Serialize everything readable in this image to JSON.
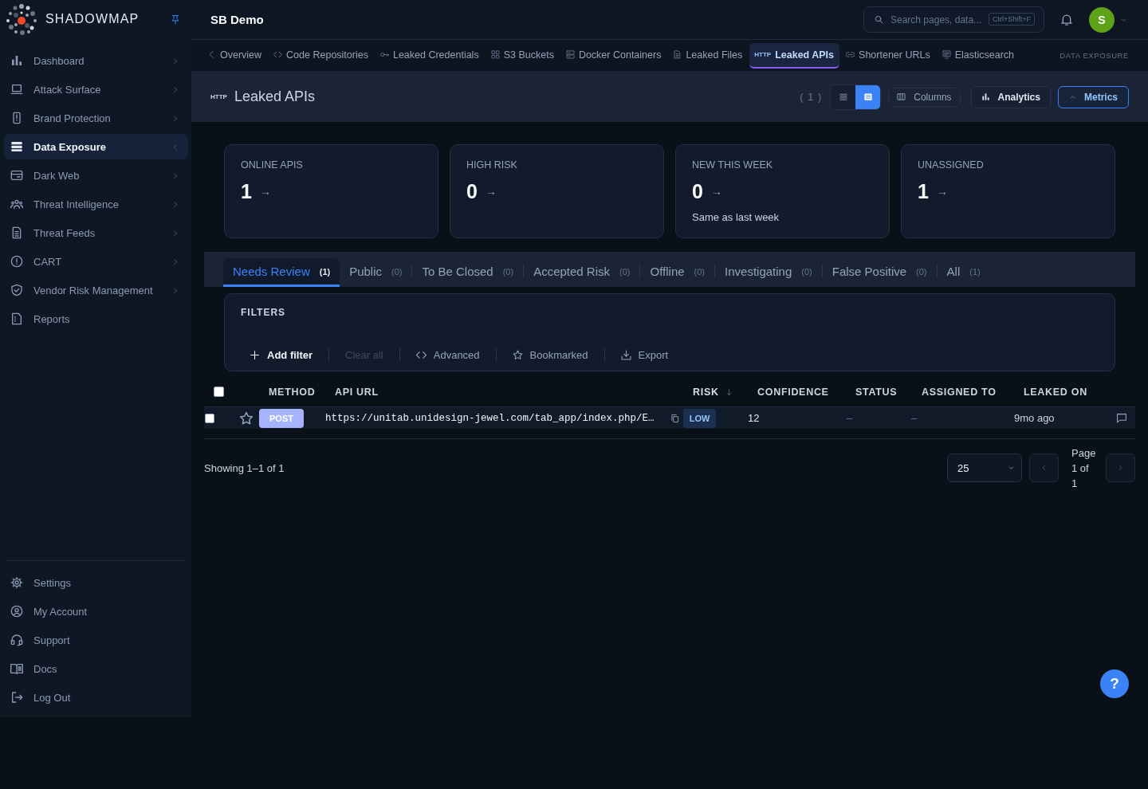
{
  "sidebar": {
    "brand": "SHADOWMAP",
    "nav": [
      {
        "label": "Dashboard",
        "kind": "dashboard",
        "selected": false,
        "submenu": true
      },
      {
        "label": "Attack Surface",
        "kind": "surface",
        "selected": false,
        "submenu": true
      },
      {
        "label": "Brand Protection",
        "kind": "brand",
        "selected": false,
        "submenu": true
      },
      {
        "label": "Data Exposure",
        "kind": "data",
        "selected": true,
        "submenu": true
      },
      {
        "label": "Dark Web",
        "kind": "darkweb",
        "selected": false,
        "submenu": true
      },
      {
        "label": "Threat Intelligence",
        "kind": "intel",
        "selected": false,
        "submenu": true
      },
      {
        "label": "Threat Feeds",
        "kind": "feeds",
        "selected": false,
        "submenu": true
      },
      {
        "label": "CART",
        "kind": "cart",
        "selected": false,
        "submenu": true
      },
      {
        "label": "Vendor Risk Management",
        "kind": "vendor",
        "selected": false,
        "submenu": true
      },
      {
        "label": "Reports",
        "kind": "reports",
        "selected": false,
        "submenu": false
      }
    ],
    "footer_nav": [
      {
        "label": "Settings",
        "kind": "settings"
      },
      {
        "label": "My Account",
        "kind": "account"
      },
      {
        "label": "Support",
        "kind": "support"
      },
      {
        "label": "Docs",
        "kind": "docs"
      },
      {
        "label": "Log Out",
        "kind": "logout"
      }
    ]
  },
  "top_bar": {
    "title": "SB Demo",
    "search": {
      "placeholder": "Search pages, data...",
      "shortcut": "Ctrl+Shift+F"
    },
    "user": {
      "initial": "S"
    }
  },
  "section_tabs": {
    "items": [
      {
        "label": "Overview",
        "kind": "back",
        "selected": false
      },
      {
        "label": "Code Repositories",
        "kind": "code",
        "selected": false
      },
      {
        "label": "Leaked Credentials",
        "kind": "key",
        "selected": false
      },
      {
        "label": "S3 Buckets",
        "kind": "bucket",
        "selected": false
      },
      {
        "label": "Docker Containers",
        "kind": "docker",
        "selected": false
      },
      {
        "label": "Leaked Files",
        "kind": "files",
        "selected": false
      },
      {
        "label": "Leaked APIs",
        "kind": "api",
        "tag": "HTTP",
        "selected": true
      },
      {
        "label": "Shortener URLs",
        "kind": "url",
        "selected": false
      },
      {
        "label": "Elasticsearch",
        "kind": "elastic",
        "selected": false
      }
    ],
    "section": "DATA EXPOSURE"
  },
  "page_header": {
    "tag": "HTTP",
    "title": "Leaked APIs",
    "count": "( 1 )",
    "views": [
      {
        "kind": "list",
        "selected": false
      },
      {
        "kind": "table",
        "selected": true
      }
    ],
    "buttons": [
      {
        "label": "Columns",
        "kind": "columns"
      },
      {
        "label": "Analytics",
        "kind": "analytics"
      }
    ],
    "metrics_toggle": {
      "label": "Metrics",
      "expanded": true
    }
  },
  "metrics": [
    {
      "label": "ONLINE APIS",
      "value": "1",
      "trend": "→"
    },
    {
      "label": "HIGH RISK",
      "value": "0",
      "trend": "→"
    },
    {
      "label": "NEW THIS WEEK",
      "value": "0",
      "trend": "→",
      "note": "Same as last week"
    },
    {
      "label": "UNASSIGNED",
      "value": "1",
      "trend": "→"
    }
  ],
  "status_tabs": [
    {
      "label": "Needs Review",
      "count": "(1)",
      "selected": true
    },
    {
      "label": "Public",
      "count": "(0)",
      "selected": false
    },
    {
      "label": "To Be Closed",
      "count": "(0)",
      "selected": false
    },
    {
      "label": "Accepted Risk",
      "count": "(0)",
      "selected": false
    },
    {
      "label": "Offline",
      "count": "(0)",
      "selected": false
    },
    {
      "label": "Investigating",
      "count": "(0)",
      "selected": false
    },
    {
      "label": "False Positive",
      "count": "(0)",
      "selected": false
    },
    {
      "label": "All",
      "count": "(1)",
      "selected": false
    }
  ],
  "filters": {
    "title": "FILTERS",
    "actions": [
      {
        "label": "Add filter",
        "kind": "add",
        "disabled": false
      },
      {
        "label": "Clear all",
        "kind": "clear",
        "disabled": true
      },
      {
        "label": "Advanced",
        "kind": "advanced",
        "disabled": false
      },
      {
        "label": "Bookmarked",
        "kind": "bookmarked",
        "disabled": false
      },
      {
        "label": "Export",
        "kind": "export",
        "disabled": false
      }
    ]
  },
  "table": {
    "select_all": {
      "checked": false
    },
    "columns": [
      {
        "label": "METHOD",
        "sorted": false
      },
      {
        "label": "API URL",
        "sorted": false
      },
      {
        "label": "RISK",
        "sorted": true
      },
      {
        "label": "CONFIDENCE",
        "sorted": false
      },
      {
        "label": "STATUS",
        "sorted": false
      },
      {
        "label": "ASSIGNED TO",
        "sorted": false
      },
      {
        "label": "LEAKED ON",
        "sorted": false
      }
    ],
    "rows": [
      {
        "checked": false,
        "bookmarked": false,
        "method": "POST",
        "api_url": "https://unitab.unidesign-jewel.com/tab_app/index.php/E…",
        "risk": "LOW",
        "confidence": "12",
        "status": "–",
        "assigned_to": "–",
        "leaked_on": "9mo ago"
      }
    ]
  },
  "pagination": {
    "summary": "Showing 1–1 of 1",
    "page_size": "25",
    "page": "Page 1 of 1"
  },
  "help": {
    "label": "?"
  }
}
